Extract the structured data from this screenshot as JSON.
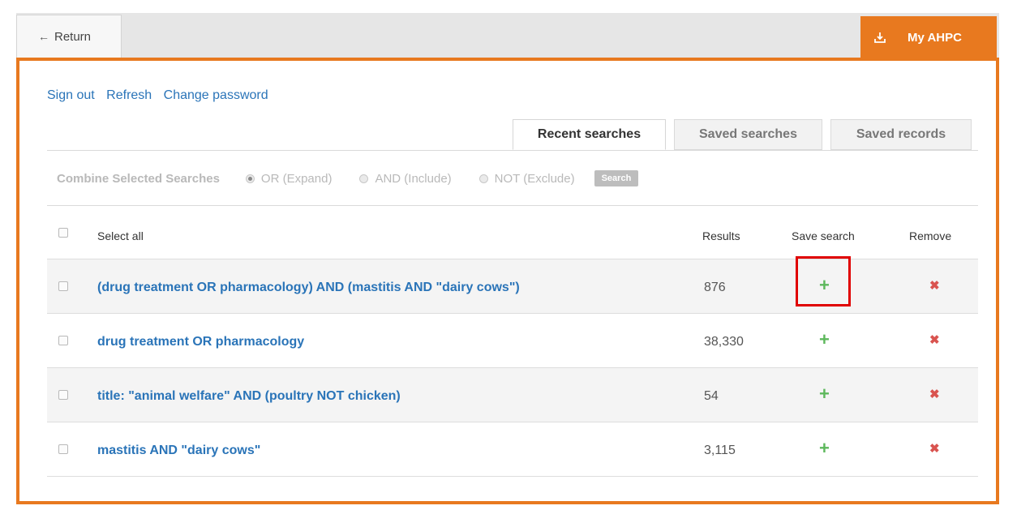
{
  "nav": {
    "return_label": "Return",
    "return_icon": "arrow-left-icon",
    "myahpc_label": "My AHPC",
    "myahpc_icon": "download-icon",
    "accent_color": "#e8791f"
  },
  "links": {
    "sign_out": "Sign out",
    "refresh": "Refresh",
    "change_password": "Change password"
  },
  "tabs": [
    {
      "label": "Recent searches",
      "active": true
    },
    {
      "label": "Saved searches",
      "active": false
    },
    {
      "label": "Saved records",
      "active": false
    }
  ],
  "combine": {
    "label": "Combine Selected Searches",
    "options": [
      {
        "label": "OR (Expand)",
        "selected": true
      },
      {
        "label": "AND (Include)",
        "selected": false
      },
      {
        "label": "NOT (Exclude)",
        "selected": false
      }
    ],
    "button_label": "Search"
  },
  "table": {
    "headers": {
      "select_all": "Select all",
      "results": "Results",
      "save_search": "Save search",
      "remove": "Remove"
    },
    "rows": [
      {
        "query": "(drug treatment OR pharmacology) AND (mastitis AND \"dairy cows\")",
        "results": "876"
      },
      {
        "query": "drug treatment OR pharmacology",
        "results": "38,330"
      },
      {
        "query": "title: \"animal welfare\" AND (poultry NOT chicken)",
        "results": "54"
      },
      {
        "query": "mastitis AND \"dairy cows\"",
        "results": "3,115"
      }
    ],
    "save_icon": "plus-icon",
    "remove_icon": "close-icon",
    "save_color": "#5db85c",
    "remove_color": "#d9534f"
  },
  "annotation": {
    "color": "#e00000"
  }
}
